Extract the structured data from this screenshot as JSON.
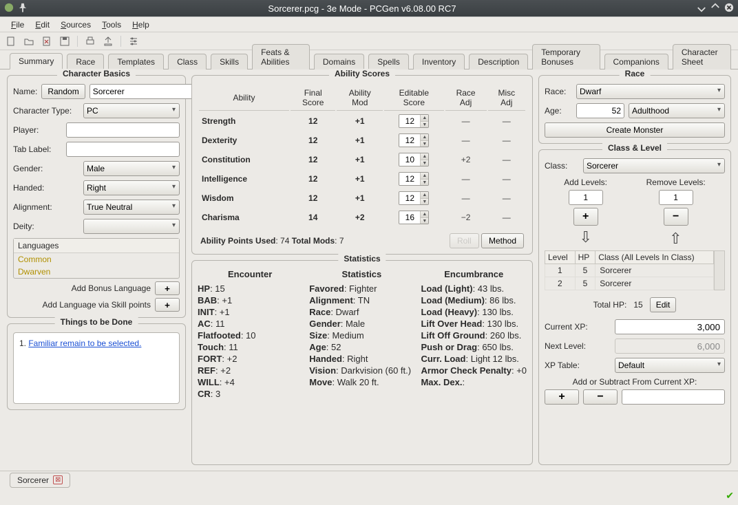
{
  "titlebar": {
    "title": "Sorcerer.pcg - 3e Mode - PCGen v6.08.00 RC7"
  },
  "menubar": [
    "File",
    "Edit",
    "Sources",
    "Tools",
    "Help"
  ],
  "tabs": [
    "Summary",
    "Race",
    "Templates",
    "Class",
    "Skills",
    "Feats & Abilities",
    "Domains",
    "Spells",
    "Inventory",
    "Description",
    "Temporary Bonuses",
    "Companions",
    "Character Sheet"
  ],
  "active_tab": "Summary",
  "basics": {
    "title": "Character Basics",
    "name_label": "Name:",
    "random": "Random",
    "name_value": "Sorcerer",
    "chartype_label": "Character Type:",
    "chartype_value": "PC",
    "player_label": "Player:",
    "player_value": "",
    "tablabel_label": "Tab Label:",
    "tablabel_value": "",
    "gender_label": "Gender:",
    "gender_value": "Male",
    "handed_label": "Handed:",
    "handed_value": "Right",
    "alignment_label": "Alignment:",
    "alignment_value": "True Neutral",
    "deity_label": "Deity:",
    "deity_value": "",
    "languages_label": "Languages",
    "languages": [
      "Common",
      "Dwarven"
    ],
    "bonus_lang": "Add Bonus Language",
    "skill_lang": "Add Language via Skill points"
  },
  "things": {
    "title": "Things to be Done",
    "items": [
      "Familiar remain to be selected."
    ]
  },
  "abilityscores": {
    "title": "Ability Scores",
    "headers": [
      "Ability",
      "Final Score",
      "Ability Mod",
      "Editable Score",
      "Race Adj",
      "Misc Adj"
    ],
    "rows": [
      {
        "name": "Strength",
        "final": "12",
        "mod": "+1",
        "edit": "12",
        "race": "—",
        "misc": "—"
      },
      {
        "name": "Dexterity",
        "final": "12",
        "mod": "+1",
        "edit": "12",
        "race": "—",
        "misc": "—"
      },
      {
        "name": "Constitution",
        "final": "12",
        "mod": "+1",
        "edit": "10",
        "race": "+2",
        "misc": "—"
      },
      {
        "name": "Intelligence",
        "final": "12",
        "mod": "+1",
        "edit": "12",
        "race": "—",
        "misc": "—"
      },
      {
        "name": "Wisdom",
        "final": "12",
        "mod": "+1",
        "edit": "12",
        "race": "—",
        "misc": "—"
      },
      {
        "name": "Charisma",
        "final": "14",
        "mod": "+2",
        "edit": "16",
        "race": "−2",
        "misc": "—"
      }
    ],
    "points_label": "Ability Points Used",
    "points_value": "74",
    "mods_label": "Total Mods",
    "mods_value": "7",
    "roll": "Roll",
    "method": "Method"
  },
  "statistics": {
    "title": "Statistics",
    "encounter_hdr": "Encounter",
    "stats_hdr": "Statistics",
    "enc_hdr": "Encumbrance",
    "encounter": [
      {
        "k": "HP",
        "v": "15"
      },
      {
        "k": "BAB",
        "v": "+1"
      },
      {
        "k": "INIT",
        "v": "+1"
      },
      {
        "k": "AC",
        "v": "11"
      },
      {
        "k": "Flatfooted",
        "v": "10"
      },
      {
        "k": "Touch",
        "v": "11"
      },
      {
        "k": "FORT",
        "v": "+2"
      },
      {
        "k": "REF",
        "v": "+2"
      },
      {
        "k": "WILL",
        "v": "+4"
      },
      {
        "k": "CR",
        "v": "3"
      }
    ],
    "stats": [
      {
        "k": "Favored",
        "v": "Fighter"
      },
      {
        "k": "Alignment",
        "v": "TN"
      },
      {
        "k": "Race",
        "v": "Dwarf"
      },
      {
        "k": "Gender",
        "v": "Male"
      },
      {
        "k": "Size",
        "v": "Medium"
      },
      {
        "k": "Age",
        "v": "52"
      },
      {
        "k": "Handed",
        "v": "Right"
      },
      {
        "k": "Vision",
        "v": "Darkvision (60 ft.)"
      },
      {
        "k": "Move",
        "v": "Walk 20 ft."
      }
    ],
    "encumbrance": [
      {
        "k": "Load (Light)",
        "v": "43 lbs."
      },
      {
        "k": "Load (Medium)",
        "v": "86 lbs."
      },
      {
        "k": "Load (Heavy)",
        "v": "130 lbs."
      },
      {
        "k": "Lift Over Head",
        "v": "130 lbs."
      },
      {
        "k": "Lift Off Ground",
        "v": "260 lbs."
      },
      {
        "k": "Push or Drag",
        "v": "650 lbs."
      },
      {
        "k": "Curr. Load",
        "v": "Light 12 lbs."
      },
      {
        "k": "Armor Check Penalty",
        "v": "+0"
      },
      {
        "k": "Max. Dex.",
        "v": ""
      }
    ]
  },
  "race": {
    "title": "Race",
    "race_label": "Race:",
    "race_value": "Dwarf",
    "age_label": "Age:",
    "age_value": "52",
    "age_stage": "Adulthood",
    "create_monster": "Create Monster"
  },
  "classlevel": {
    "title": "Class & Level",
    "class_label": "Class:",
    "class_value": "Sorcerer",
    "add_label": "Add Levels:",
    "remove_label": "Remove Levels:",
    "add_value": "1",
    "remove_value": "1",
    "tbl_headers": [
      "Level",
      "HP",
      "Class (All Levels In Class)"
    ],
    "tbl_rows": [
      {
        "level": "1",
        "hp": "5",
        "cls": "Sorcerer"
      },
      {
        "level": "2",
        "hp": "5",
        "cls": "Sorcerer"
      }
    ],
    "total_hp_label": "Total HP:",
    "total_hp_value": "15",
    "edit": "Edit",
    "curxp_label": "Current XP:",
    "curxp_value": "3,000",
    "nextxp_label": "Next Level:",
    "nextxp_value": "6,000",
    "xptable_label": "XP Table:",
    "xptable_value": "Default",
    "addsub_label": "Add or Subtract From Current XP:"
  },
  "bottom_tab": "Sorcerer"
}
